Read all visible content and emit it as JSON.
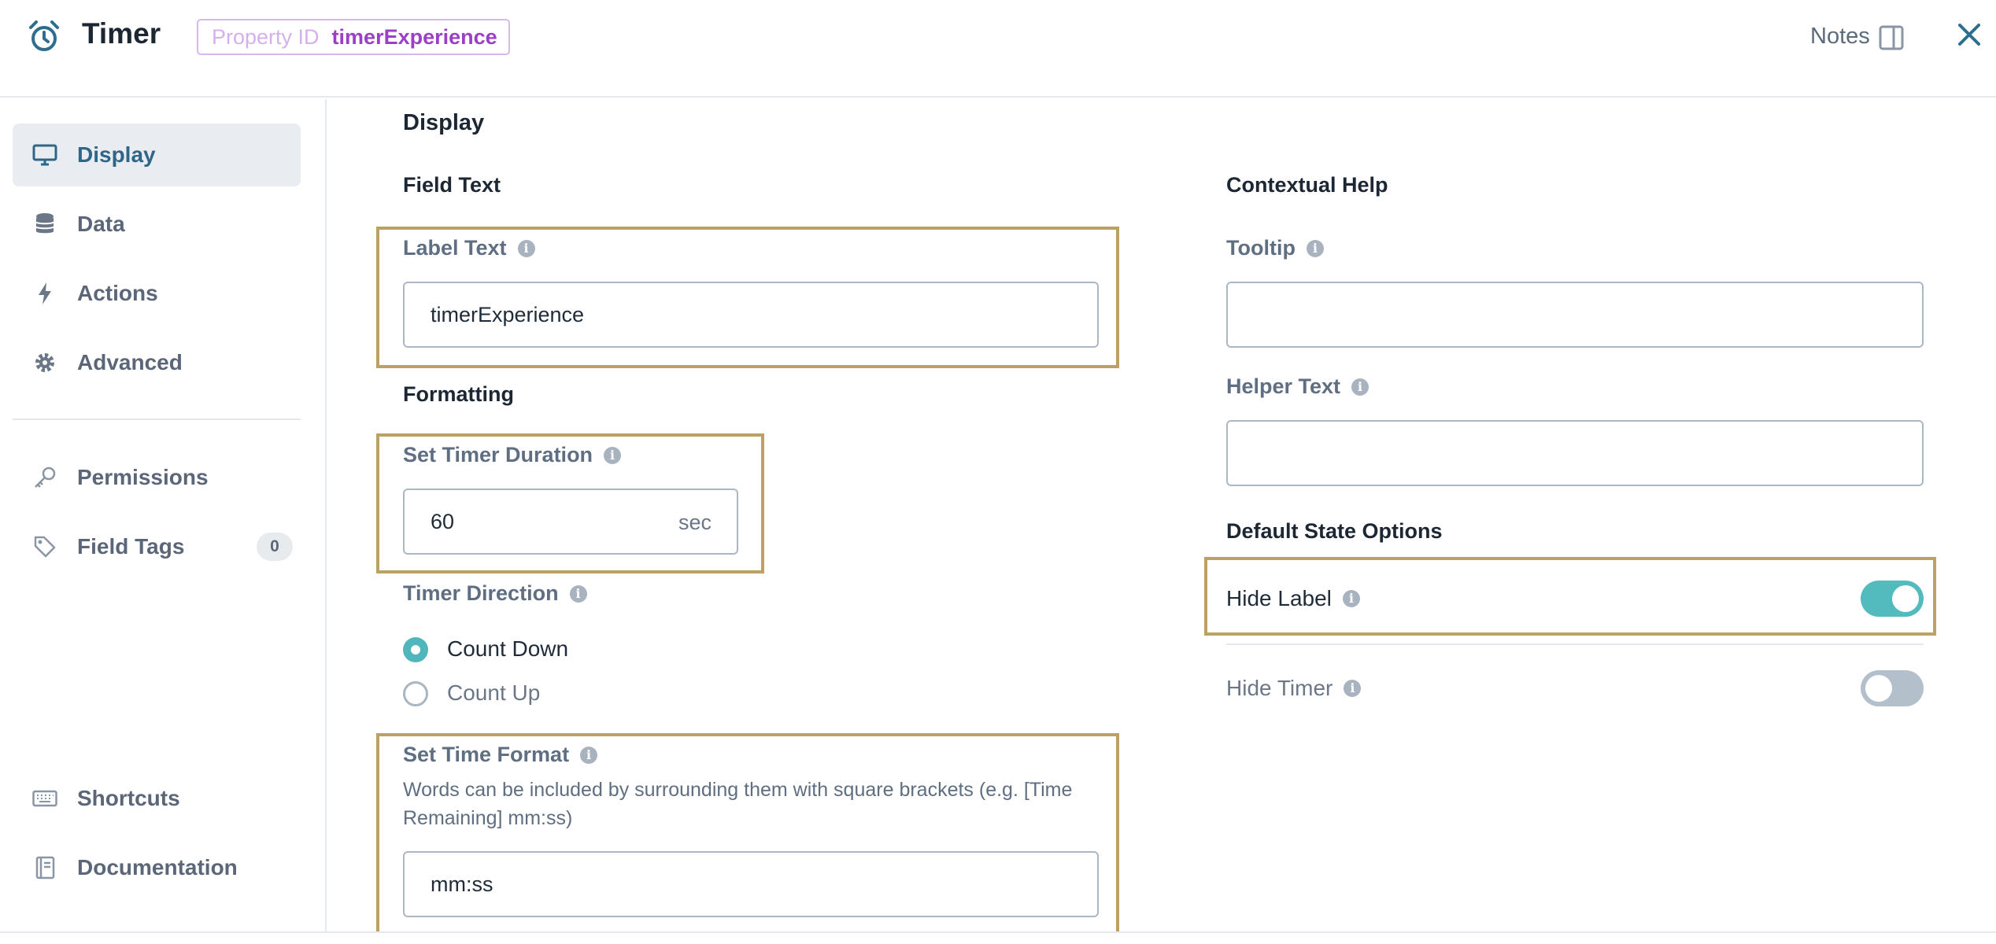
{
  "header": {
    "title": "Timer",
    "icon": "alarm-clock-icon",
    "property_id_label": "Property ID",
    "property_id_value": "timerExperience",
    "notes_label": "Notes"
  },
  "sidebar": {
    "items": [
      {
        "label": "Display",
        "icon": "monitor-icon",
        "active": true
      },
      {
        "label": "Data",
        "icon": "database-icon"
      },
      {
        "label": "Actions",
        "icon": "lightning-icon"
      },
      {
        "label": "Advanced",
        "icon": "gear-icon"
      },
      {
        "label": "Permissions",
        "icon": "key-icon"
      },
      {
        "label": "Field Tags",
        "icon": "tag-icon",
        "count": "0"
      },
      {
        "label": "Shortcuts",
        "icon": "keyboard-icon"
      },
      {
        "label": "Documentation",
        "icon": "book-icon"
      }
    ]
  },
  "main": {
    "section_title": "Display",
    "field_text": {
      "title": "Field Text",
      "label_text": {
        "label": "Label Text",
        "value": "timerExperience"
      }
    },
    "formatting": {
      "title": "Formatting",
      "duration": {
        "label": "Set Timer Duration",
        "value": "60",
        "unit": "sec"
      },
      "direction": {
        "label": "Timer Direction",
        "options": [
          "Count Down",
          "Count Up"
        ],
        "selected": "Count Down"
      },
      "time_format": {
        "label": "Set Time Format",
        "help_line1": "Words can be included by surrounding them with square brackets (e.g. [Time",
        "help_line2": "Remaining] mm:ss)",
        "value": "mm:ss"
      }
    },
    "contextual_help": {
      "title": "Contextual Help",
      "tooltip": {
        "label": "Tooltip",
        "value": ""
      },
      "helper_text": {
        "label": "Helper Text",
        "value": ""
      }
    },
    "default_state": {
      "title": "Default State Options",
      "hide_label": {
        "label": "Hide Label",
        "on": true
      },
      "hide_timer": {
        "label": "Hide Timer",
        "on": false
      }
    }
  },
  "colors": {
    "accent": "#4fb6bc",
    "highlight": "#bba263",
    "badge": "#9b3fc9"
  }
}
